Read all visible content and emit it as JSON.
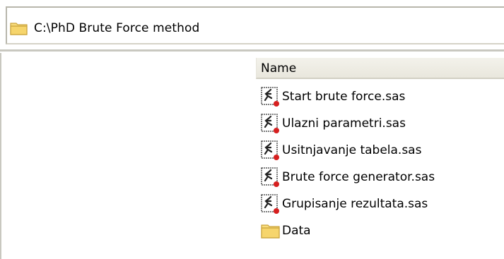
{
  "address_bar": {
    "path": "C:\\PhD Brute Force method",
    "icon": "folder-icon"
  },
  "list_view": {
    "columns": [
      {
        "label": "Name"
      }
    ],
    "items": [
      {
        "name": "Start brute force.sas",
        "icon": "sas-program-icon"
      },
      {
        "name": "Ulazni parametri.sas",
        "icon": "sas-program-icon"
      },
      {
        "name": "Usitnjavanje tabela.sas",
        "icon": "sas-program-icon"
      },
      {
        "name": "Brute force generator.sas",
        "icon": "sas-program-icon"
      },
      {
        "name": "Grupisanje rezultata.sas",
        "icon": "sas-program-icon"
      },
      {
        "name": "Data",
        "icon": "folder-icon"
      }
    ]
  },
  "colors": {
    "folder_fill": "#f6d56c",
    "folder_stroke": "#c9a23a",
    "border": "#b8b7ac",
    "header_bg": "#ece9d8",
    "sas_dot": "#d61f1f"
  }
}
